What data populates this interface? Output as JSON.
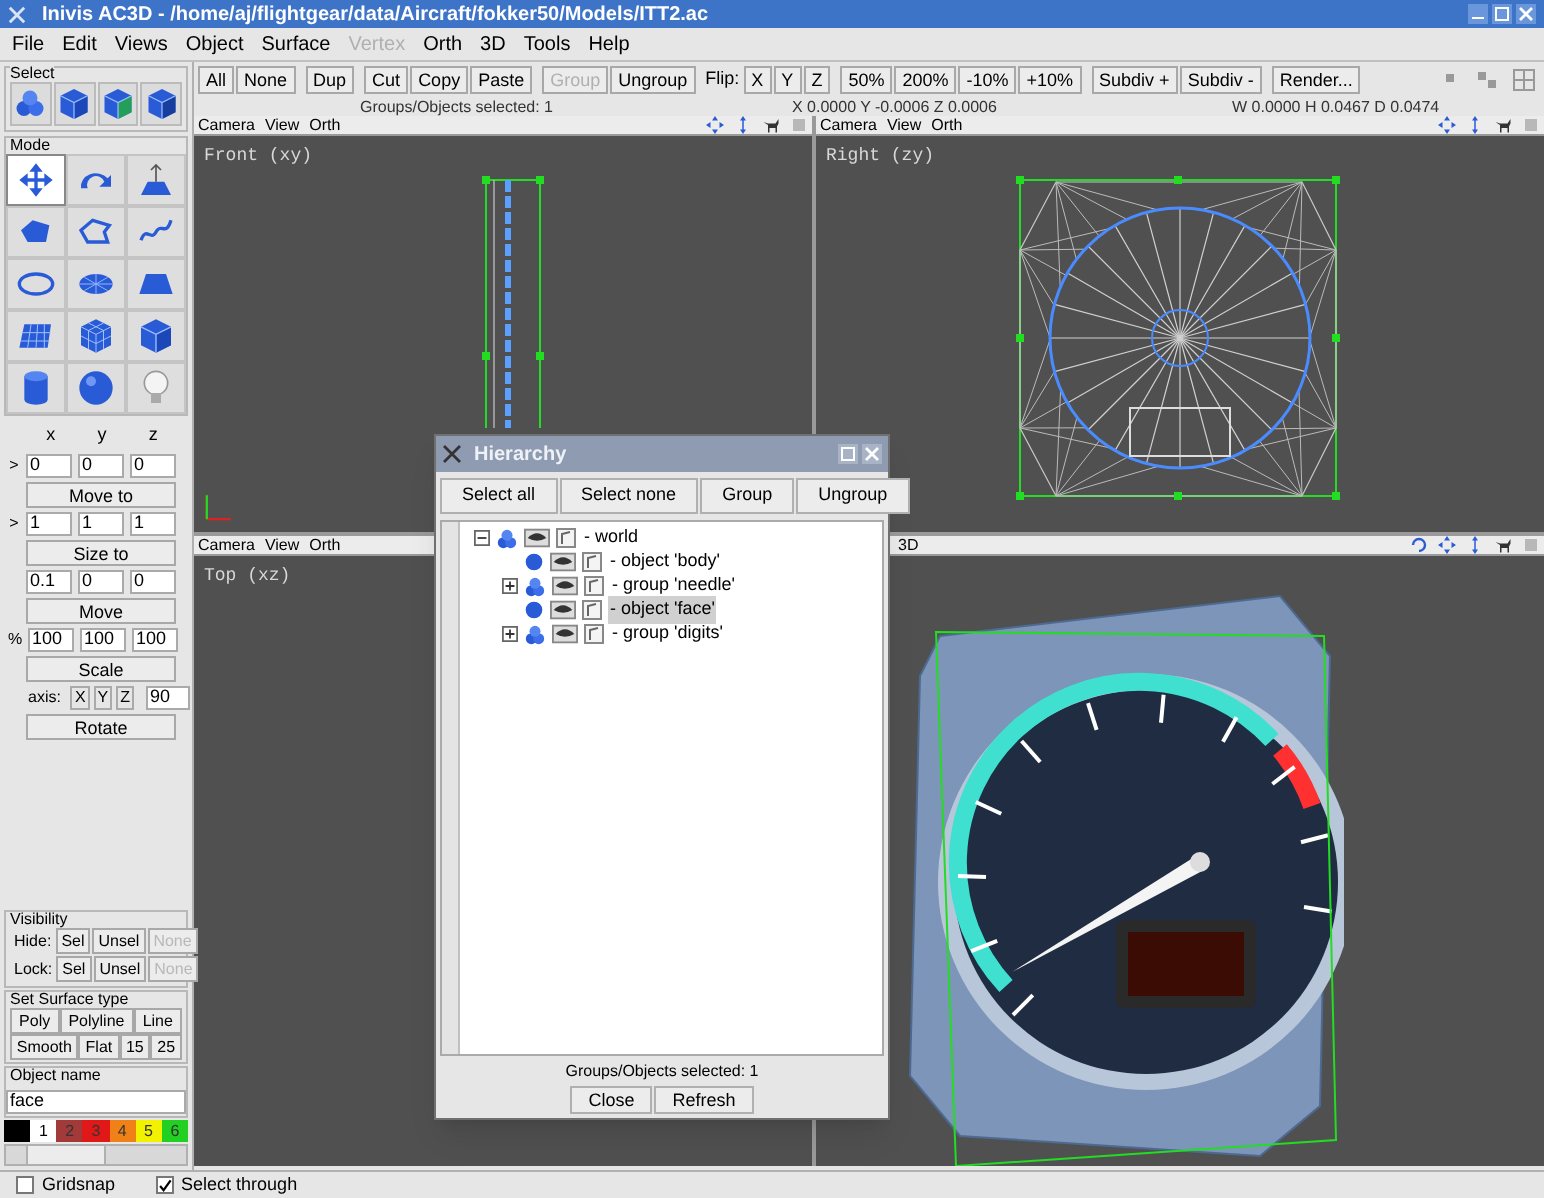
{
  "window": {
    "title": "Inivis AC3D - /home/aj/flightgear/data/Aircraft/fokker50/Models/ITT2.ac"
  },
  "menu": [
    {
      "label": "File",
      "disabled": false
    },
    {
      "label": "Edit",
      "disabled": false
    },
    {
      "label": "Views",
      "disabled": false
    },
    {
      "label": "Object",
      "disabled": false
    },
    {
      "label": "Surface",
      "disabled": false
    },
    {
      "label": "Vertex",
      "disabled": true
    },
    {
      "label": "Orth",
      "disabled": false
    },
    {
      "label": "3D",
      "disabled": false
    },
    {
      "label": "Tools",
      "disabled": false
    },
    {
      "label": "Help",
      "disabled": false
    }
  ],
  "toolbar": {
    "groups": [
      [
        {
          "kind": "button",
          "label": "All",
          "disabled": false
        },
        {
          "kind": "button",
          "label": "None",
          "disabled": false
        }
      ],
      [
        {
          "kind": "button",
          "label": "Dup",
          "disabled": false
        }
      ],
      [
        {
          "kind": "button",
          "label": "Cut",
          "disabled": false
        },
        {
          "kind": "button",
          "label": "Copy",
          "disabled": false
        },
        {
          "kind": "button",
          "label": "Paste",
          "disabled": false
        }
      ],
      [
        {
          "kind": "button",
          "label": "Group",
          "disabled": true
        },
        {
          "kind": "button",
          "label": "Ungroup",
          "disabled": false
        }
      ],
      [
        {
          "kind": "label",
          "label": "Flip:"
        },
        {
          "kind": "button",
          "label": "X",
          "disabled": false
        },
        {
          "kind": "button",
          "label": "Y",
          "disabled": false
        },
        {
          "kind": "button",
          "label": "Z",
          "disabled": false
        }
      ],
      [
        {
          "kind": "button",
          "label": "50%",
          "disabled": false
        },
        {
          "kind": "button",
          "label": "200%",
          "disabled": false
        },
        {
          "kind": "button",
          "label": "-10%",
          "disabled": false
        },
        {
          "kind": "button",
          "label": "+10%",
          "disabled": false
        }
      ],
      [
        {
          "kind": "button",
          "label": "Subdiv +",
          "disabled": false
        },
        {
          "kind": "button",
          "label": "Subdiv -",
          "disabled": false
        }
      ],
      [
        {
          "kind": "button",
          "label": "Render...",
          "disabled": false
        }
      ]
    ]
  },
  "status": {
    "selected": "Groups/Objects selected: 1",
    "position": "X 0.0000 Y -0.0006 Z 0.0006",
    "size": "W 0.0000 H 0.0467 D 0.0474"
  },
  "left_panel": {
    "select_title": "Select",
    "mode_title": "Mode",
    "mode_tools": [
      {
        "selected": true
      },
      {
        "selected": false
      },
      {
        "selected": false
      },
      {
        "selected": false
      },
      {
        "selected": false
      },
      {
        "selected": false
      },
      {
        "selected": false
      },
      {
        "selected": false
      },
      {
        "selected": false
      },
      {
        "selected": false
      },
      {
        "selected": false
      },
      {
        "selected": false
      },
      {
        "selected": false
      },
      {
        "selected": false
      },
      {
        "selected": false
      }
    ],
    "axis_headers": [
      "x",
      "y",
      "z"
    ],
    "transforms": [
      {
        "prefix": ">",
        "values": [
          "0",
          "0",
          "0"
        ],
        "button": "Move to"
      },
      {
        "prefix": ">",
        "values": [
          "1",
          "1",
          "1"
        ],
        "button": "Size to"
      },
      {
        "values": [
          "0.1",
          "0",
          "0"
        ],
        "button": "Move"
      },
      {
        "prefix": "%",
        "values": [
          "100",
          "100",
          "100"
        ],
        "button": "Scale"
      }
    ],
    "rotate": {
      "label": "axis:",
      "axes": [
        "X",
        "Y",
        "Z"
      ],
      "angle": "90",
      "button": "Rotate"
    },
    "visibility": {
      "title": "Visibility",
      "rows": [
        {
          "label": "Hide:",
          "buttons": [
            {
              "label": "Sel",
              "disabled": false
            },
            {
              "label": "Unsel",
              "disabled": false
            },
            {
              "label": "None",
              "disabled": true
            }
          ]
        },
        {
          "label": "Lock:",
          "buttons": [
            {
              "label": "Sel",
              "disabled": false
            },
            {
              "label": "Unsel",
              "disabled": false
            },
            {
              "label": "None",
              "disabled": true
            }
          ]
        }
      ]
    },
    "surface": {
      "title": "Set Surface type",
      "type_buttons": [
        "Poly",
        "Polyline",
        "Line"
      ],
      "shading_buttons": [
        "Smooth",
        "Flat",
        "15",
        "25"
      ]
    },
    "object_name": {
      "title": "Object name",
      "value": "face"
    },
    "palette": [
      {
        "color": "#000000"
      },
      {
        "label": "1",
        "color": "#ffffff"
      },
      {
        "label": "2",
        "color": "#a33a3a"
      },
      {
        "label": "3",
        "color": "#e01818"
      },
      {
        "label": "4",
        "color": "#f08018"
      },
      {
        "label": "5",
        "color": "#f2f200"
      },
      {
        "label": "6",
        "color": "#22d022"
      }
    ]
  },
  "viewports": [
    {
      "kind": "front",
      "header": [
        "Camera",
        "View",
        "Orth"
      ],
      "label": "Front (xy)"
    },
    {
      "kind": "right",
      "header": [
        "Camera",
        "View",
        "Orth"
      ],
      "label": "Right (zy)"
    },
    {
      "kind": "top",
      "header": [
        "Camera",
        "View",
        "Orth"
      ],
      "label": "Top (xz)"
    },
    {
      "kind": "perspective",
      "header": [
        "3D"
      ]
    }
  ],
  "hierarchy": {
    "title": "Hierarchy",
    "buttons": [
      "Select all",
      "Select none",
      "Group",
      "Ungroup"
    ],
    "tree": [
      {
        "kind": "group",
        "label": "- world",
        "expanded": true,
        "selected": false,
        "children": [
          {
            "kind": "object",
            "label": "- object 'body'",
            "selected": false
          },
          {
            "kind": "group",
            "label": "- group 'needle'",
            "expanded": false,
            "selected": false
          },
          {
            "kind": "object",
            "label": "- object 'face'",
            "selected": true
          },
          {
            "kind": "group",
            "label": "- group 'digits'",
            "expanded": false,
            "selected": false
          }
        ]
      }
    ],
    "status": "Groups/Objects selected: 1",
    "footer_buttons": [
      "Close",
      "Refresh"
    ]
  },
  "options": [
    {
      "label": "Gridsnap",
      "checked": false
    },
    {
      "label": "Select through",
      "checked": true
    }
  ]
}
